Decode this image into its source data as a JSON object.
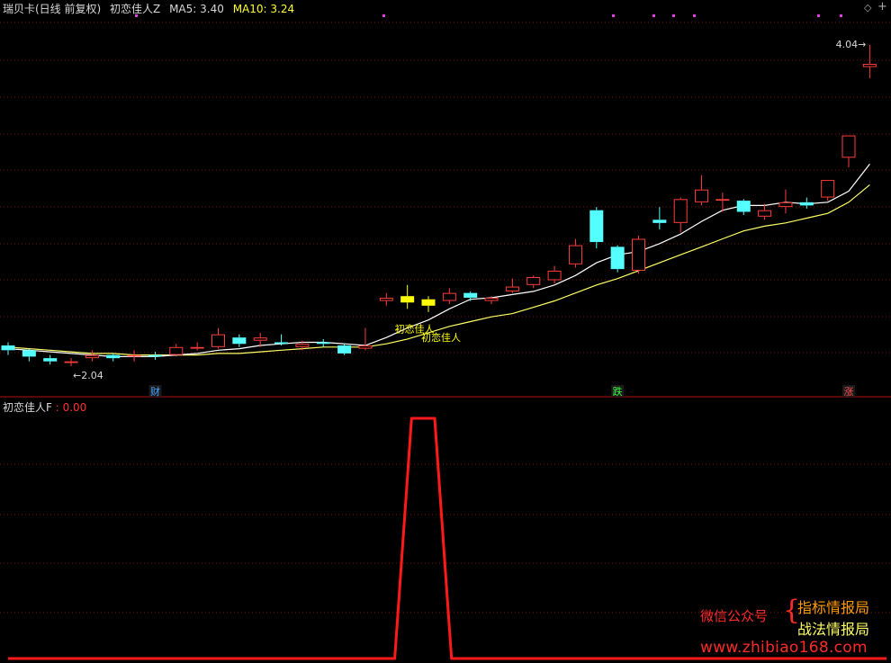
{
  "header": {
    "title": "瑞贝卡(日线 前复权)",
    "indicator": "初恋佳人Z",
    "ma5_label": "MA5:",
    "ma5_value": "3.40",
    "ma10_label": "MA10:",
    "ma10_value": "3.24"
  },
  "subheader": {
    "indicator": "初恋佳人F",
    "value": ": 0.00"
  },
  "controls": {
    "diamond": "◇",
    "plus": "+"
  },
  "watermark": {
    "gzh": "微信公众号",
    "brace": "{",
    "line1": "指标情报局",
    "line2": "战法情报局",
    "url": "www.zhibiao168.com"
  },
  "colors": {
    "up": "#ff3c3c",
    "down": "#54ffff",
    "signal": "#ffff00",
    "ma5": "#ffffff",
    "ma10": "#ffff66",
    "indicator_line": "#ff1a1a",
    "grid": "#7a0f0f",
    "divider": "#b01010"
  },
  "chart_data": [
    {
      "type": "candlestick",
      "price_range": [
        1.89,
        4.18
      ],
      "candles": [
        {
          "o": 2.15,
          "c": 2.12,
          "h": 2.17,
          "l": 2.09
        },
        {
          "o": 2.12,
          "c": 2.08,
          "h": 2.13,
          "l": 2.05
        },
        {
          "o": 2.07,
          "c": 2.05,
          "h": 2.09,
          "l": 2.03
        },
        {
          "o": 2.04,
          "c": 2.05,
          "h": 2.07,
          "l": 2.02
        },
        {
          "o": 2.07,
          "c": 2.09,
          "h": 2.12,
          "l": 2.05
        },
        {
          "o": 2.09,
          "c": 2.07,
          "h": 2.1,
          "l": 2.05
        },
        {
          "o": 2.08,
          "c": 2.09,
          "h": 2.12,
          "l": 2.05
        },
        {
          "o": 2.09,
          "c": 2.08,
          "h": 2.11,
          "l": 2.06
        },
        {
          "o": 2.09,
          "c": 2.14,
          "h": 2.16,
          "l": 2.08
        },
        {
          "o": 2.13,
          "c": 2.14,
          "h": 2.17,
          "l": 2.12
        },
        {
          "o": 2.14,
          "c": 2.22,
          "h": 2.26,
          "l": 2.13
        },
        {
          "o": 2.2,
          "c": 2.16,
          "h": 2.22,
          "l": 2.14
        },
        {
          "o": 2.18,
          "c": 2.2,
          "h": 2.23,
          "l": 2.14
        },
        {
          "o": 2.17,
          "c": 2.16,
          "h": 2.22,
          "l": 2.15
        },
        {
          "o": 2.14,
          "c": 2.16,
          "h": 2.18,
          "l": 2.12
        },
        {
          "o": 2.17,
          "c": 2.16,
          "h": 2.19,
          "l": 2.14
        },
        {
          "o": 2.15,
          "c": 2.1,
          "h": 2.16,
          "l": 2.09
        },
        {
          "o": 2.13,
          "c": 2.15,
          "h": 2.26,
          "l": 2.12
        },
        {
          "o": 2.43,
          "c": 2.45,
          "h": 2.48,
          "l": 2.4
        },
        {
          "o": 2.42,
          "c": 2.46,
          "h": 2.53,
          "l": 2.38,
          "signal": true
        },
        {
          "o": 2.4,
          "c": 2.44,
          "h": 2.46,
          "l": 2.36,
          "signal": true
        },
        {
          "o": 2.43,
          "c": 2.48,
          "h": 2.51,
          "l": 2.41
        },
        {
          "o": 2.48,
          "c": 2.45,
          "h": 2.49,
          "l": 2.43
        },
        {
          "o": 2.43,
          "c": 2.45,
          "h": 2.46,
          "l": 2.41
        },
        {
          "o": 2.49,
          "c": 2.52,
          "h": 2.57,
          "l": 2.48
        },
        {
          "o": 2.53,
          "c": 2.58,
          "h": 2.59,
          "l": 2.51
        },
        {
          "o": 2.56,
          "c": 2.62,
          "h": 2.65,
          "l": 2.54
        },
        {
          "o": 2.66,
          "c": 2.78,
          "h": 2.82,
          "l": 2.64
        },
        {
          "o": 3.0,
          "c": 2.8,
          "h": 3.02,
          "l": 2.76
        },
        {
          "o": 2.77,
          "c": 2.63,
          "h": 2.78,
          "l": 2.61
        },
        {
          "o": 2.62,
          "c": 2.82,
          "h": 2.84,
          "l": 2.6
        },
        {
          "o": 2.94,
          "c": 2.92,
          "h": 3.02,
          "l": 2.88
        },
        {
          "o": 2.92,
          "c": 3.07,
          "h": 3.08,
          "l": 2.86
        },
        {
          "o": 3.05,
          "c": 3.13,
          "h": 3.22,
          "l": 3.03
        },
        {
          "o": 3.06,
          "c": 3.07,
          "h": 3.11,
          "l": 2.99
        },
        {
          "o": 3.06,
          "c": 2.99,
          "h": 3.07,
          "l": 2.97
        },
        {
          "o": 2.96,
          "c": 3.0,
          "h": 3.04,
          "l": 2.94
        },
        {
          "o": 3.02,
          "c": 3.05,
          "h": 3.13,
          "l": 2.98
        },
        {
          "o": 3.05,
          "c": 3.03,
          "h": 3.08,
          "l": 3.01
        },
        {
          "o": 3.08,
          "c": 3.19,
          "h": 3.19,
          "l": 3.06
        },
        {
          "o": 3.33,
          "c": 3.47,
          "h": 3.47,
          "l": 3.27
        },
        {
          "o": 3.9,
          "c": 3.92,
          "h": 4.04,
          "l": 3.83
        }
      ],
      "ma5": [
        2.13,
        2.12,
        2.11,
        2.1,
        2.09,
        2.08,
        2.08,
        2.08,
        2.09,
        2.1,
        2.12,
        2.13,
        2.15,
        2.16,
        2.17,
        2.17,
        2.16,
        2.15,
        2.2,
        2.26,
        2.31,
        2.38,
        2.44,
        2.45,
        2.47,
        2.49,
        2.53,
        2.59,
        2.67,
        2.72,
        2.74,
        2.79,
        2.85,
        2.93,
        3.0,
        3.03,
        3.03,
        3.05,
        3.04,
        3.05,
        3.12,
        3.29
      ],
      "ma10": [
        2.14,
        2.13,
        2.12,
        2.11,
        2.1,
        2.1,
        2.09,
        2.09,
        2.09,
        2.09,
        2.1,
        2.1,
        2.11,
        2.12,
        2.13,
        2.14,
        2.14,
        2.14,
        2.16,
        2.19,
        2.23,
        2.27,
        2.3,
        2.33,
        2.35,
        2.39,
        2.43,
        2.48,
        2.53,
        2.57,
        2.62,
        2.67,
        2.72,
        2.77,
        2.82,
        2.87,
        2.9,
        2.92,
        2.95,
        2.98,
        3.05,
        3.16
      ],
      "annotations": [
        {
          "text": "←2.04",
          "candle": 3,
          "at": "low"
        },
        {
          "text": "4.04→",
          "candle": 41,
          "at": "high"
        },
        {
          "text": "初恋佳人",
          "candle": 19,
          "at": "below"
        },
        {
          "text": "初恋佳人",
          "candle": 20,
          "at": "below"
        }
      ],
      "markers": [
        {
          "label": "财",
          "candle": 7,
          "color": "#4aa3ff"
        },
        {
          "label": "跌",
          "candle": 29,
          "color": "#3cff3c"
        },
        {
          "label": "涨",
          "candle": 40,
          "color": "#ff5050"
        }
      ]
    },
    {
      "type": "line",
      "name": "初恋佳人F",
      "y_range": [
        0,
        1
      ],
      "x": [
        0,
        18.4,
        19.2,
        20.3,
        21.1,
        41.8
      ],
      "y": [
        0,
        0,
        1,
        1,
        0,
        0
      ]
    }
  ]
}
